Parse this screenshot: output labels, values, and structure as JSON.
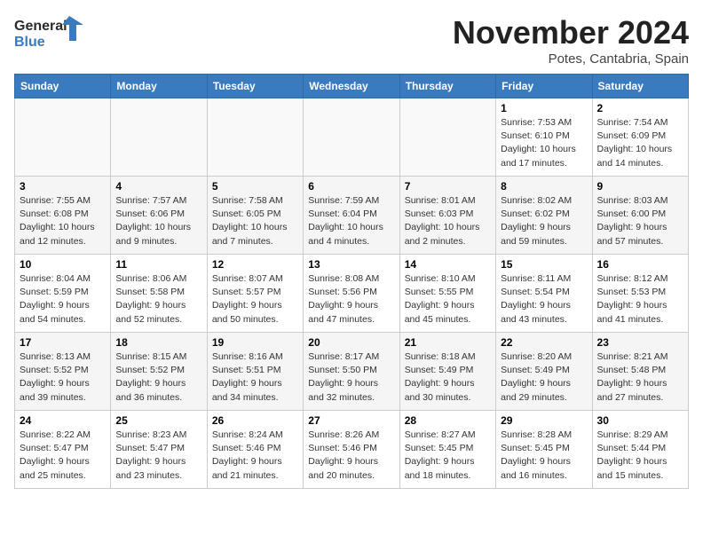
{
  "logo": {
    "line1": "General",
    "line2": "Blue"
  },
  "title": "November 2024",
  "location": "Potes, Cantabria, Spain",
  "headers": [
    "Sunday",
    "Monday",
    "Tuesday",
    "Wednesday",
    "Thursday",
    "Friday",
    "Saturday"
  ],
  "weeks": [
    [
      {
        "day": "",
        "info": ""
      },
      {
        "day": "",
        "info": ""
      },
      {
        "day": "",
        "info": ""
      },
      {
        "day": "",
        "info": ""
      },
      {
        "day": "",
        "info": ""
      },
      {
        "day": "1",
        "info": "Sunrise: 7:53 AM\nSunset: 6:10 PM\nDaylight: 10 hours and 17 minutes."
      },
      {
        "day": "2",
        "info": "Sunrise: 7:54 AM\nSunset: 6:09 PM\nDaylight: 10 hours and 14 minutes."
      }
    ],
    [
      {
        "day": "3",
        "info": "Sunrise: 7:55 AM\nSunset: 6:08 PM\nDaylight: 10 hours and 12 minutes."
      },
      {
        "day": "4",
        "info": "Sunrise: 7:57 AM\nSunset: 6:06 PM\nDaylight: 10 hours and 9 minutes."
      },
      {
        "day": "5",
        "info": "Sunrise: 7:58 AM\nSunset: 6:05 PM\nDaylight: 10 hours and 7 minutes."
      },
      {
        "day": "6",
        "info": "Sunrise: 7:59 AM\nSunset: 6:04 PM\nDaylight: 10 hours and 4 minutes."
      },
      {
        "day": "7",
        "info": "Sunrise: 8:01 AM\nSunset: 6:03 PM\nDaylight: 10 hours and 2 minutes."
      },
      {
        "day": "8",
        "info": "Sunrise: 8:02 AM\nSunset: 6:02 PM\nDaylight: 9 hours and 59 minutes."
      },
      {
        "day": "9",
        "info": "Sunrise: 8:03 AM\nSunset: 6:00 PM\nDaylight: 9 hours and 57 minutes."
      }
    ],
    [
      {
        "day": "10",
        "info": "Sunrise: 8:04 AM\nSunset: 5:59 PM\nDaylight: 9 hours and 54 minutes."
      },
      {
        "day": "11",
        "info": "Sunrise: 8:06 AM\nSunset: 5:58 PM\nDaylight: 9 hours and 52 minutes."
      },
      {
        "day": "12",
        "info": "Sunrise: 8:07 AM\nSunset: 5:57 PM\nDaylight: 9 hours and 50 minutes."
      },
      {
        "day": "13",
        "info": "Sunrise: 8:08 AM\nSunset: 5:56 PM\nDaylight: 9 hours and 47 minutes."
      },
      {
        "day": "14",
        "info": "Sunrise: 8:10 AM\nSunset: 5:55 PM\nDaylight: 9 hours and 45 minutes."
      },
      {
        "day": "15",
        "info": "Sunrise: 8:11 AM\nSunset: 5:54 PM\nDaylight: 9 hours and 43 minutes."
      },
      {
        "day": "16",
        "info": "Sunrise: 8:12 AM\nSunset: 5:53 PM\nDaylight: 9 hours and 41 minutes."
      }
    ],
    [
      {
        "day": "17",
        "info": "Sunrise: 8:13 AM\nSunset: 5:52 PM\nDaylight: 9 hours and 39 minutes."
      },
      {
        "day": "18",
        "info": "Sunrise: 8:15 AM\nSunset: 5:52 PM\nDaylight: 9 hours and 36 minutes."
      },
      {
        "day": "19",
        "info": "Sunrise: 8:16 AM\nSunset: 5:51 PM\nDaylight: 9 hours and 34 minutes."
      },
      {
        "day": "20",
        "info": "Sunrise: 8:17 AM\nSunset: 5:50 PM\nDaylight: 9 hours and 32 minutes."
      },
      {
        "day": "21",
        "info": "Sunrise: 8:18 AM\nSunset: 5:49 PM\nDaylight: 9 hours and 30 minutes."
      },
      {
        "day": "22",
        "info": "Sunrise: 8:20 AM\nSunset: 5:49 PM\nDaylight: 9 hours and 29 minutes."
      },
      {
        "day": "23",
        "info": "Sunrise: 8:21 AM\nSunset: 5:48 PM\nDaylight: 9 hours and 27 minutes."
      }
    ],
    [
      {
        "day": "24",
        "info": "Sunrise: 8:22 AM\nSunset: 5:47 PM\nDaylight: 9 hours and 25 minutes."
      },
      {
        "day": "25",
        "info": "Sunrise: 8:23 AM\nSunset: 5:47 PM\nDaylight: 9 hours and 23 minutes."
      },
      {
        "day": "26",
        "info": "Sunrise: 8:24 AM\nSunset: 5:46 PM\nDaylight: 9 hours and 21 minutes."
      },
      {
        "day": "27",
        "info": "Sunrise: 8:26 AM\nSunset: 5:46 PM\nDaylight: 9 hours and 20 minutes."
      },
      {
        "day": "28",
        "info": "Sunrise: 8:27 AM\nSunset: 5:45 PM\nDaylight: 9 hours and 18 minutes."
      },
      {
        "day": "29",
        "info": "Sunrise: 8:28 AM\nSunset: 5:45 PM\nDaylight: 9 hours and 16 minutes."
      },
      {
        "day": "30",
        "info": "Sunrise: 8:29 AM\nSunset: 5:44 PM\nDaylight: 9 hours and 15 minutes."
      }
    ]
  ]
}
